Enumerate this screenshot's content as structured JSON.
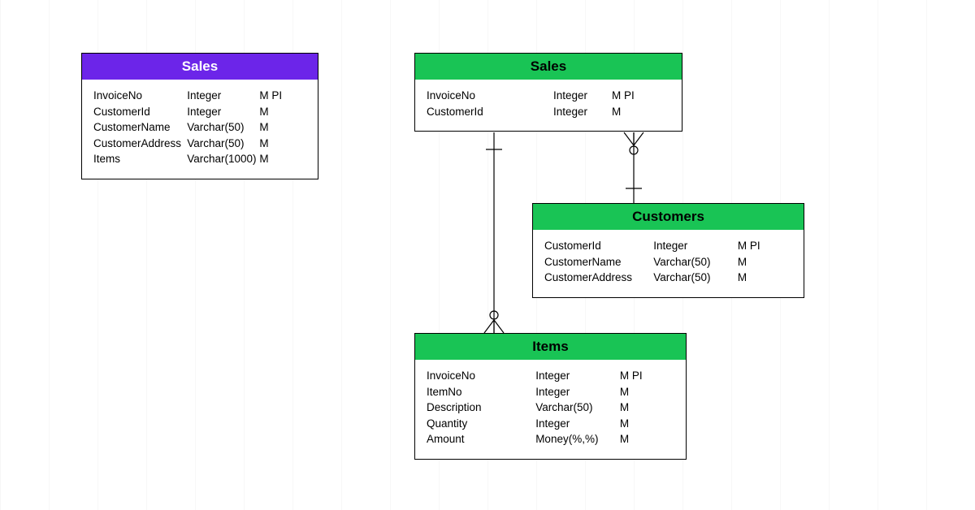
{
  "colors": {
    "purple": "#6c25e9",
    "green": "#19c455"
  },
  "entities": {
    "sales_purple": {
      "title": "Sales",
      "rows": [
        {
          "name": "InvoiceNo",
          "type": "Integer",
          "flags": "M PI"
        },
        {
          "name": "CustomerId",
          "type": "Integer",
          "flags": "M"
        },
        {
          "name": "CustomerName",
          "type": "Varchar(50)",
          "flags": "M"
        },
        {
          "name": "CustomerAddress",
          "type": "Varchar(50)",
          "flags": "M"
        },
        {
          "name": "Items",
          "type": "Varchar(1000)",
          "flags": "M"
        }
      ]
    },
    "sales_green": {
      "title": "Sales",
      "rows": [
        {
          "name": "InvoiceNo",
          "type": "Integer",
          "flags": "M PI"
        },
        {
          "name": "CustomerId",
          "type": "Integer",
          "flags": "M"
        }
      ]
    },
    "customers": {
      "title": "Customers",
      "rows": [
        {
          "name": "CustomerId",
          "type": "Integer",
          "flags": "M PI"
        },
        {
          "name": "CustomerName",
          "type": "Varchar(50)",
          "flags": "M"
        },
        {
          "name": "CustomerAddress",
          "type": "Varchar(50)",
          "flags": "M"
        }
      ]
    },
    "items": {
      "title": "Items",
      "rows": [
        {
          "name": "InvoiceNo",
          "type": "Integer",
          "flags": "M PI"
        },
        {
          "name": "ItemNo",
          "type": "Integer",
          "flags": "M"
        },
        {
          "name": "Description",
          "type": "Varchar(50)",
          "flags": "M"
        },
        {
          "name": "Quantity",
          "type": "Integer",
          "flags": "M"
        },
        {
          "name": "Amount",
          "type": "Money(%,%)",
          "flags": "M"
        }
      ]
    }
  }
}
